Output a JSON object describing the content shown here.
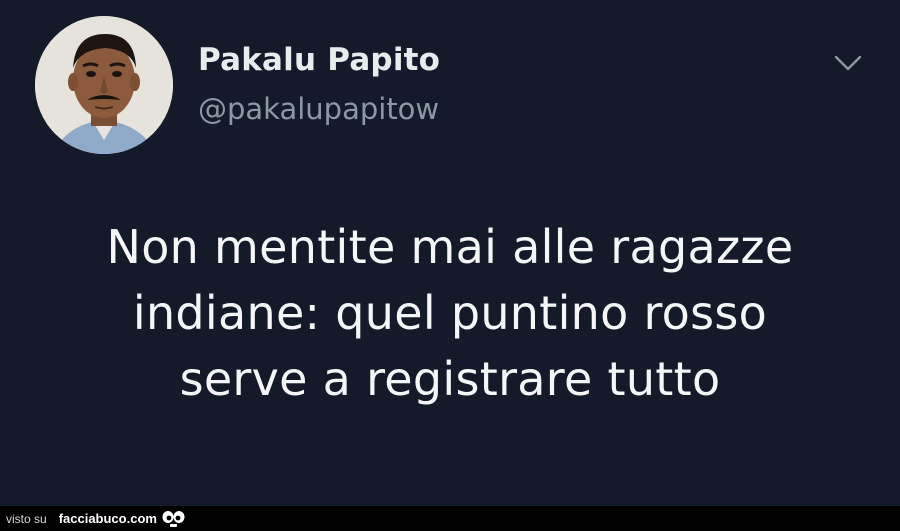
{
  "tweet": {
    "display_name": "Pakalu Papito",
    "handle": "@pakalupapitow",
    "text_lines": [
      "Non mentite mai alle ragazze",
      "indiane: quel puntino rosso",
      "serve a registrare tutto"
    ],
    "menu_icon": "chevron-down-icon",
    "avatar_icon": "avatar-photo"
  },
  "footer": {
    "prefix": "visto su",
    "site": "facciabuco.com",
    "logo_icon": "eyes-logo-icon"
  },
  "colors": {
    "background": "#141a29",
    "name": "#e9ecef",
    "handle": "#8b98a5",
    "text": "#f4f6f8",
    "footer_bg": "#000000"
  }
}
